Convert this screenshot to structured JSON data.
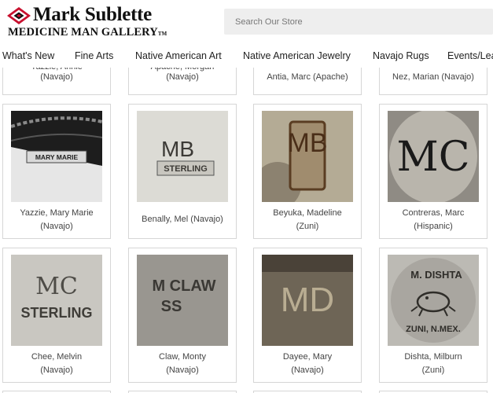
{
  "brand": {
    "title": "Mark Sublette",
    "subtitle": "MEDICINE MAN GALLERY",
    "tm": "TM"
  },
  "search": {
    "placeholder": "Search Our Store"
  },
  "nav": [
    "What's New",
    "Fine Arts",
    "Native American Art",
    "Native American Jewelry",
    "Navajo Rugs",
    "Events/Lea"
  ],
  "top_row": [
    {
      "name": "Yazzie, Annie",
      "tribe": "(Navajo)"
    },
    {
      "name": "Apache, Morgan",
      "tribe": "(Navajo)"
    },
    {
      "name": "Antia, Marc (Apache)",
      "tribe": ""
    },
    {
      "name": "Nez, Marian (Navajo)",
      "tribe": ""
    }
  ],
  "cards": [
    {
      "name": "Yazzie, Mary Marie",
      "tribe": "(Navajo)",
      "mark_text": "MARY MARIE"
    },
    {
      "name": "Benally, Mel (Navajo)",
      "tribe": "",
      "mark_text": "MB",
      "mark_sub": "STERLING"
    },
    {
      "name": "Beyuka, Madeline",
      "tribe": "(Zuni)",
      "mark_text": "MB"
    },
    {
      "name": "Contreras, Marc",
      "tribe": "(Hispanic)",
      "mark_text": "MC"
    },
    {
      "name": "Chee, Melvin",
      "tribe": "(Navajo)",
      "mark_text": "MC",
      "mark_sub": "STERLING"
    },
    {
      "name": "Claw, Monty",
      "tribe": "(Navajo)",
      "mark_text": "M CLAW",
      "mark_sub": "SS"
    },
    {
      "name": "Dayee, Mary",
      "tribe": "(Navajo)",
      "mark_text": "MD"
    },
    {
      "name": "Dishta, Milburn",
      "tribe": "(Zuni)",
      "mark_text": "M. DISHTA",
      "mark_sub": "ZUNI, N.MEX."
    }
  ],
  "colors": {
    "logo_red": "#c8102e",
    "search_bg": "#eeeeee",
    "card_border": "#d6d6d6"
  }
}
